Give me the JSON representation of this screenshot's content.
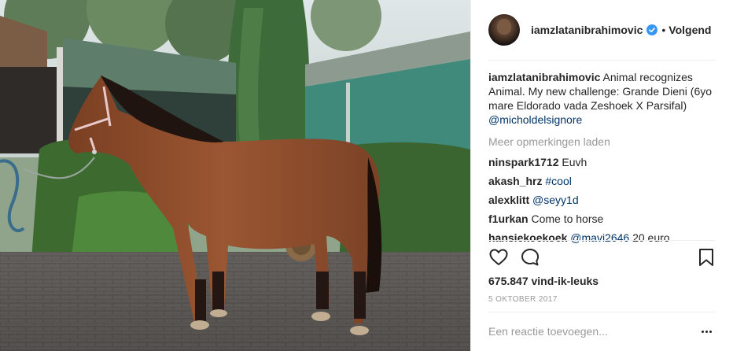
{
  "post": {
    "username": "iamzlatanibrahimovic",
    "follow_label": "Volgend",
    "separator": "•",
    "caption": {
      "user": "iamzlatanibrahimovic",
      "text": " Animal recognizes Animal. My new challenge: Grande Dieni (6yo mare Eldorado vada Zeshoek X Parsifal) ",
      "mention": "@micholdelsignore"
    },
    "load_more": "Meer opmerkingen laden",
    "comments": [
      {
        "user": "ninspark1712",
        "text": "Euvh",
        "mention": ""
      },
      {
        "user": "akash_hrz",
        "text": "",
        "mention": "#cool"
      },
      {
        "user": "alexklitt",
        "text": "",
        "mention": "@seyy1d"
      },
      {
        "user": "f1urkan",
        "text": "Come to horse",
        "mention": ""
      },
      {
        "user": "hansiekoekoek",
        "text": "20 euro",
        "mention": "@mavi2646"
      }
    ],
    "likes": "675.847 vind-ik-leuks",
    "date": "5 OKTOBER 2017",
    "comment_placeholder": "Een reactie toevoegen..."
  },
  "icons": {
    "verified": "verified-badge-icon",
    "like": "heart-icon",
    "comment": "comment-bubble-icon",
    "save": "bookmark-icon",
    "more": "more-options-icon"
  },
  "colors": {
    "text": "#262626",
    "muted": "#999999",
    "mention": "#003569",
    "verified": "#3897f0",
    "divider": "#efefef"
  }
}
